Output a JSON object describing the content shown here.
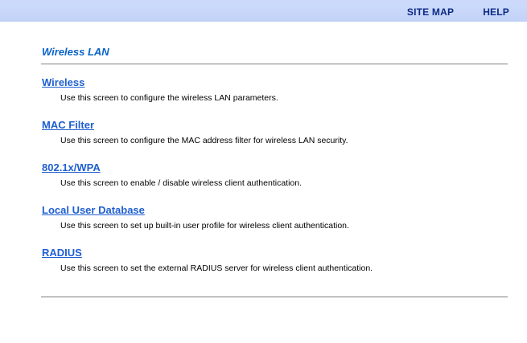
{
  "nav": {
    "site_map": "SITE MAP",
    "help": "HELP"
  },
  "page": {
    "title": "Wireless LAN"
  },
  "sections": [
    {
      "link": "Wireless",
      "description": "Use this screen to configure the wireless LAN parameters."
    },
    {
      "link": "MAC Filter",
      "description": "Use this screen to configure the MAC address filter for wireless LAN security."
    },
    {
      "link": "802.1x/WPA",
      "description": "Use this screen to enable / disable wireless client authentication."
    },
    {
      "link": "Local User Database",
      "description": "Use this screen to set up built-in user profile for wireless client authentication."
    },
    {
      "link": "RADIUS",
      "description": "Use this screen to set the external RADIUS server for wireless client authentication."
    }
  ],
  "colors": {
    "header_band": "#c2d2f7",
    "nav_text": "#0c2a83",
    "title": "#0a63c9",
    "link": "#1e5fd0"
  }
}
